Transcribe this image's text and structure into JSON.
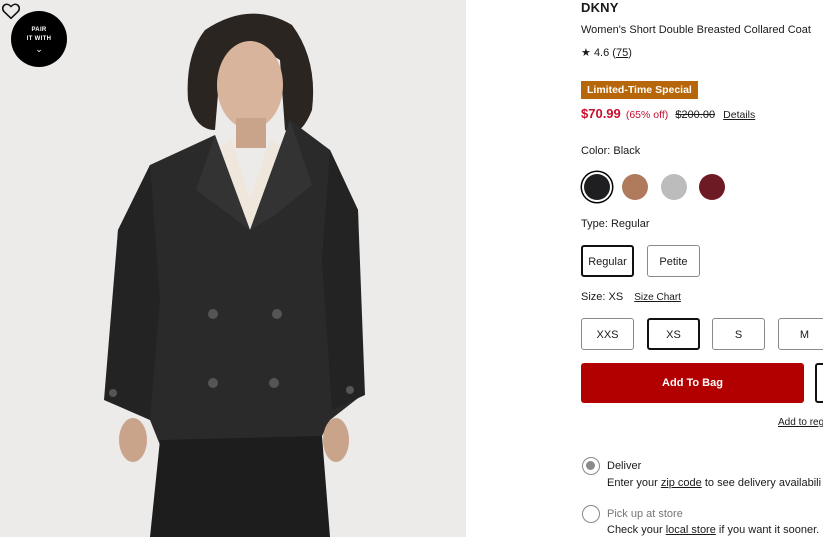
{
  "gallery": {
    "pair_with": {
      "line1": "PAIR",
      "line2": "IT WITH",
      "icon": "chevron-down-icon"
    },
    "favorite_icon": "heart-icon"
  },
  "product": {
    "brand": "DKNY",
    "name": "Women's Short Double Breasted Collared Coat",
    "rating": {
      "star_icon": "star-icon",
      "value": "4.6",
      "count": "75"
    },
    "badge": "Limited-Time Special",
    "price": {
      "sale": "$70.99",
      "discount": "(65% off)",
      "original": "$200.00",
      "details_link": "Details"
    }
  },
  "color": {
    "label": "Color: Black",
    "swatches": [
      {
        "name": "Black",
        "hex": "#1f1f21",
        "selected": true
      },
      {
        "name": "Camel",
        "hex": "#b07a5c",
        "selected": false
      },
      {
        "name": "Grey",
        "hex": "#bcbcbc",
        "selected": false
      },
      {
        "name": "Burgundy",
        "hex": "#6e1a24",
        "selected": false
      }
    ]
  },
  "type": {
    "label": "Type: Regular",
    "options": [
      {
        "label": "Regular",
        "selected": true
      },
      {
        "label": "Petite",
        "selected": false
      }
    ]
  },
  "size": {
    "label": "Size: XS",
    "chart_link": "Size Chart",
    "options": [
      {
        "label": "XXS",
        "selected": false
      },
      {
        "label": "XS",
        "selected": true
      },
      {
        "label": "S",
        "selected": false
      },
      {
        "label": "M",
        "selected": false
      }
    ]
  },
  "actions": {
    "add_to_bag": "Add To Bag",
    "registry_link": "Add to reg"
  },
  "fulfillment": {
    "deliver": {
      "title": "Deliver",
      "sub_before": "Enter your",
      "link": "zip code",
      "sub_after": "to see delivery availabili"
    },
    "pickup": {
      "title": "Pick up at store",
      "sub_before": "Check your",
      "link": "local store",
      "sub_after": "if you want it sooner."
    }
  },
  "colors": {
    "sale_red": "#c8102e",
    "add_to_bag_bg": "#b20000",
    "badge_bg": "#b8660a"
  }
}
